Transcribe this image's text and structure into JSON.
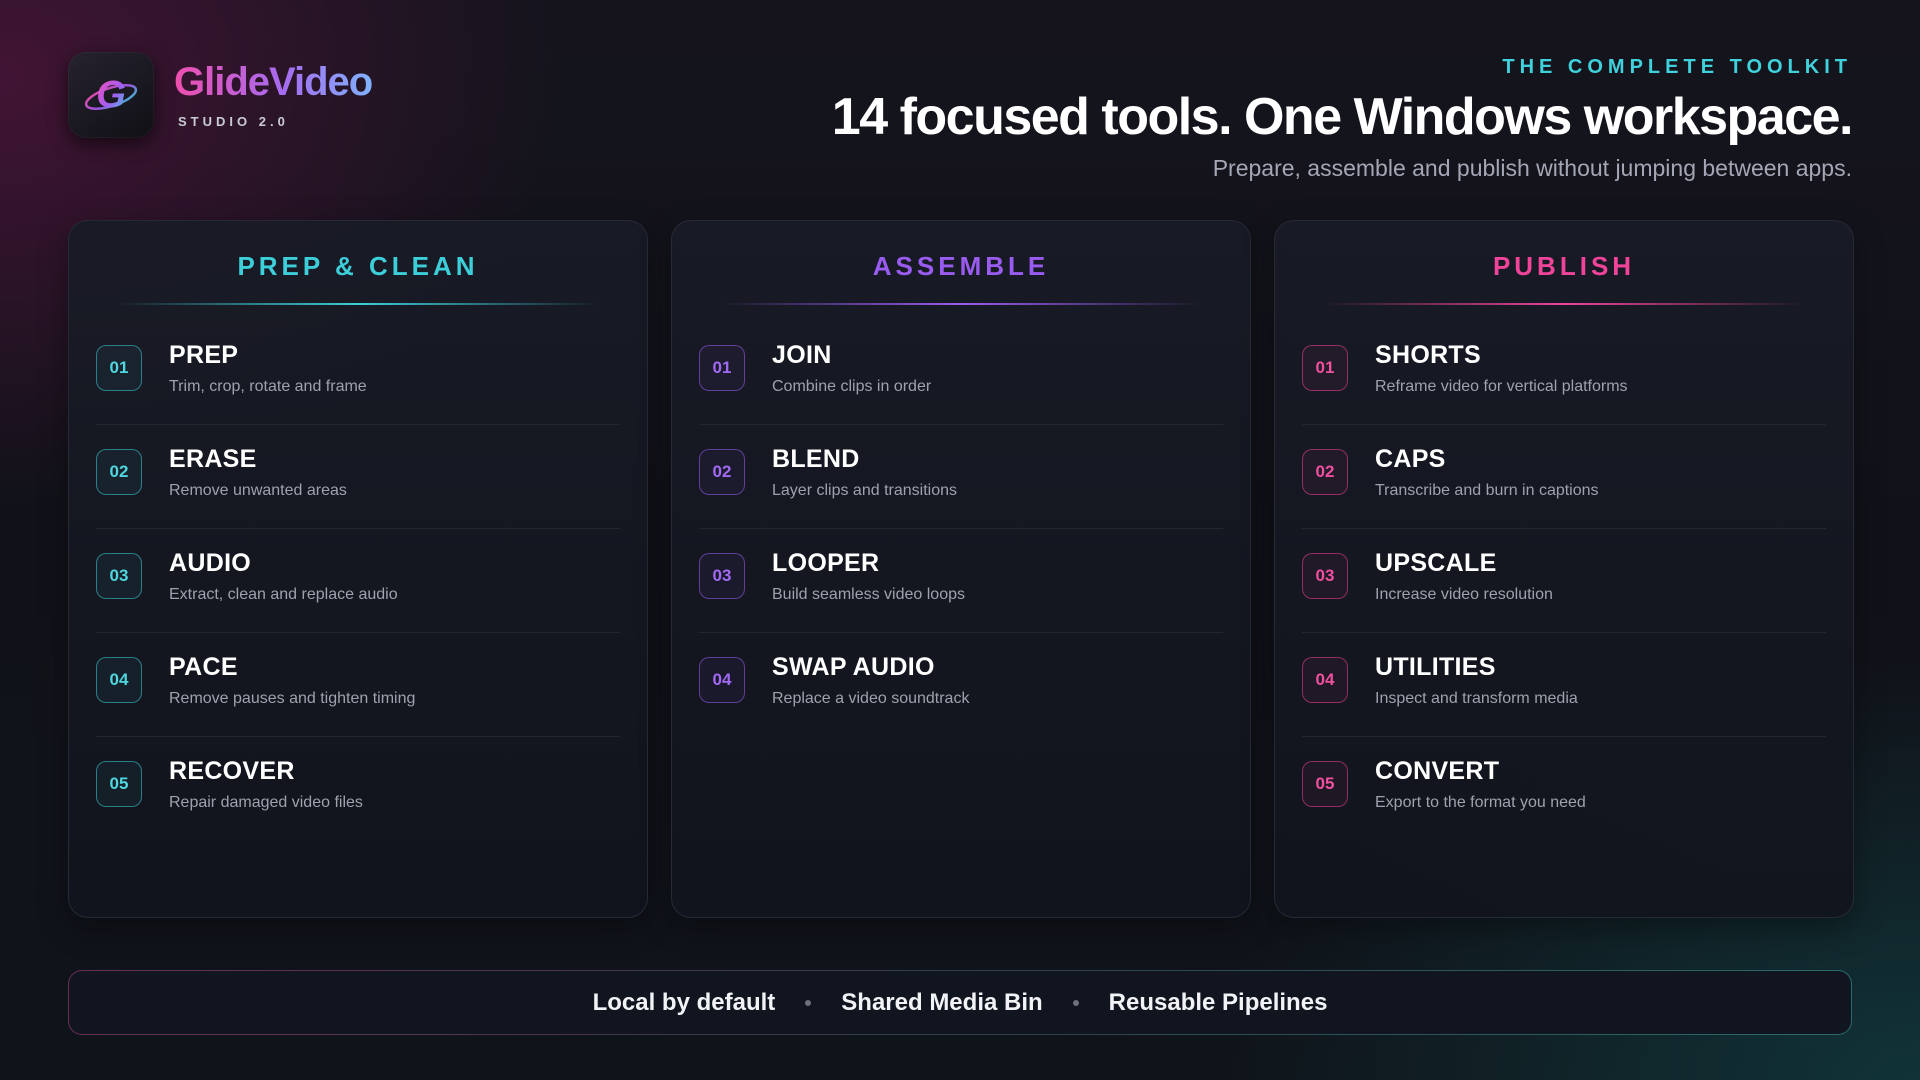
{
  "brand": {
    "name": "GlideVideo",
    "subtitle": "STUDIO 2.0",
    "logo_letter": "G",
    "logo_icon": "glide-g-logo-icon"
  },
  "hero": {
    "eyebrow": "THE COMPLETE TOOLKIT",
    "headline": "14 focused tools. One Windows workspace.",
    "subline": "Prepare, assemble and publish without jumping between apps."
  },
  "colors": {
    "teal": "#3dcfd9",
    "purple": "#9a5cf0",
    "pink": "#f0449a",
    "background": "#121319"
  },
  "columns": [
    {
      "title": "PREP & CLEAN",
      "accent": "teal",
      "tools": [
        {
          "num": "01",
          "name": "PREP",
          "desc": "Trim, crop, rotate and frame"
        },
        {
          "num": "02",
          "name": "ERASE",
          "desc": "Remove unwanted areas"
        },
        {
          "num": "03",
          "name": "AUDIO",
          "desc": "Extract, clean and replace audio"
        },
        {
          "num": "04",
          "name": "PACE",
          "desc": "Remove pauses and tighten timing"
        },
        {
          "num": "05",
          "name": "RECOVER",
          "desc": "Repair damaged video files"
        }
      ]
    },
    {
      "title": "ASSEMBLE",
      "accent": "purple",
      "tools": [
        {
          "num": "01",
          "name": "JOIN",
          "desc": "Combine clips in order"
        },
        {
          "num": "02",
          "name": "BLEND",
          "desc": "Layer clips and transitions"
        },
        {
          "num": "03",
          "name": "LOOPER",
          "desc": "Build seamless video loops"
        },
        {
          "num": "04",
          "name": "SWAP AUDIO",
          "desc": "Replace a video soundtrack"
        }
      ]
    },
    {
      "title": "PUBLISH",
      "accent": "pink",
      "tools": [
        {
          "num": "01",
          "name": "SHORTS",
          "desc": "Reframe video for vertical platforms"
        },
        {
          "num": "02",
          "name": "CAPS",
          "desc": "Transcribe and burn in captions"
        },
        {
          "num": "03",
          "name": "UPSCALE",
          "desc": "Increase video resolution"
        },
        {
          "num": "04",
          "name": "UTILITIES",
          "desc": "Inspect and transform media"
        },
        {
          "num": "05",
          "name": "CONVERT",
          "desc": "Export to the format you need"
        }
      ]
    }
  ],
  "footer": {
    "features": [
      "Local by default",
      "Shared Media Bin",
      "Reusable Pipelines"
    ]
  }
}
